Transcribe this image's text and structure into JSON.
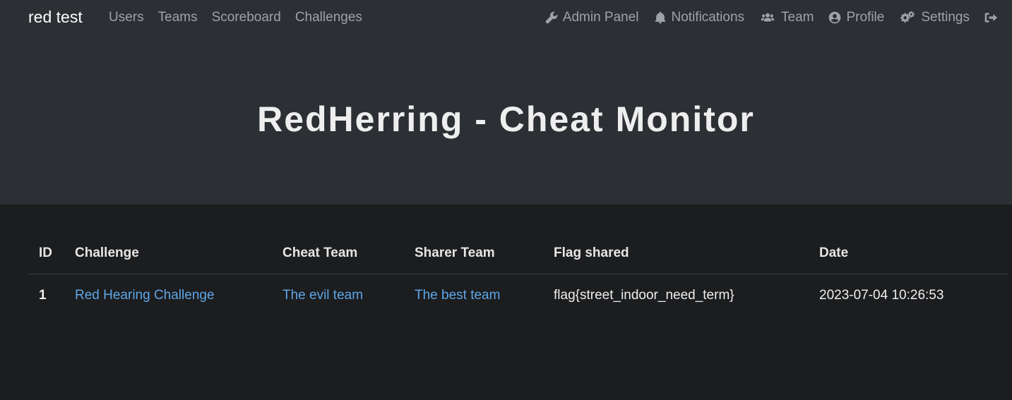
{
  "nav": {
    "brand": "red test",
    "left": [
      "Users",
      "Teams",
      "Scoreboard",
      "Challenges"
    ],
    "right": [
      {
        "label": "Admin Panel",
        "icon": "wrench-icon"
      },
      {
        "label": "Notifications",
        "icon": "bell-icon"
      },
      {
        "label": "Team",
        "icon": "users-icon"
      },
      {
        "label": "Profile",
        "icon": "user-circle-icon"
      },
      {
        "label": "Settings",
        "icon": "cogs-icon"
      }
    ],
    "logout_icon": "sign-out-icon"
  },
  "page": {
    "title": "RedHerring - Cheat Monitor"
  },
  "table": {
    "headers": [
      "ID",
      "Challenge",
      "Cheat Team",
      "Sharer Team",
      "Flag shared",
      "Date"
    ],
    "rows": [
      {
        "id": "1",
        "challenge": "Red Hearing Challenge",
        "cheat_team": "The evil team",
        "sharer_team": "The best team",
        "flag": "flag{street_indoor_need_term}",
        "date": "2023-07-04 10:26:53"
      }
    ]
  },
  "colors": {
    "header_bg": "#2c2f33",
    "body_bg": "#1c1d1f",
    "link": "#5ea6e6",
    "nav_text": "#9ea3a8"
  }
}
